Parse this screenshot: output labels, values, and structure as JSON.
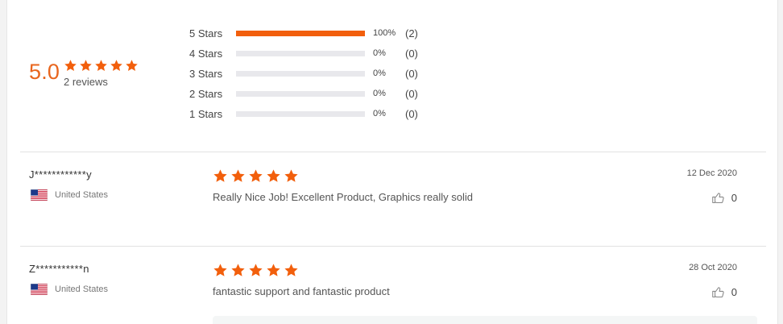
{
  "summary": {
    "average": "5.0",
    "rating_out_of_5": 5,
    "reviews_count": "2 reviews"
  },
  "distribution": [
    {
      "label": "5 Stars",
      "fraction": 1.0,
      "percent": "100%",
      "count": "(2)"
    },
    {
      "label": "4 Stars",
      "fraction": 0.0,
      "percent": "0%",
      "count": "(0)"
    },
    {
      "label": "3 Stars",
      "fraction": 0.0,
      "percent": "0%",
      "count": "(0)"
    },
    {
      "label": "2 Stars",
      "fraction": 0.0,
      "percent": "0%",
      "count": "(0)"
    },
    {
      "label": "1 Stars",
      "fraction": 0.0,
      "percent": "0%",
      "count": "(0)"
    }
  ],
  "reviews": [
    {
      "reviewer": "J************y",
      "country": "United States",
      "flag_icon": "us-flag-icon",
      "rating": 5,
      "text": "Really Nice Job! Excellent Product, Graphics really solid",
      "date": "12 Dec 2020",
      "helpful_count": "0"
    },
    {
      "reviewer": "Z***********n",
      "country": "United States",
      "flag_icon": "us-flag-icon",
      "rating": 5,
      "text": "fantastic support and fantastic product",
      "date": "28 Oct 2020",
      "helpful_count": "0"
    }
  ],
  "colors": {
    "accent": "#f25f0c",
    "average_text": "#e8651d",
    "bar_track": "#e8e8ec"
  }
}
